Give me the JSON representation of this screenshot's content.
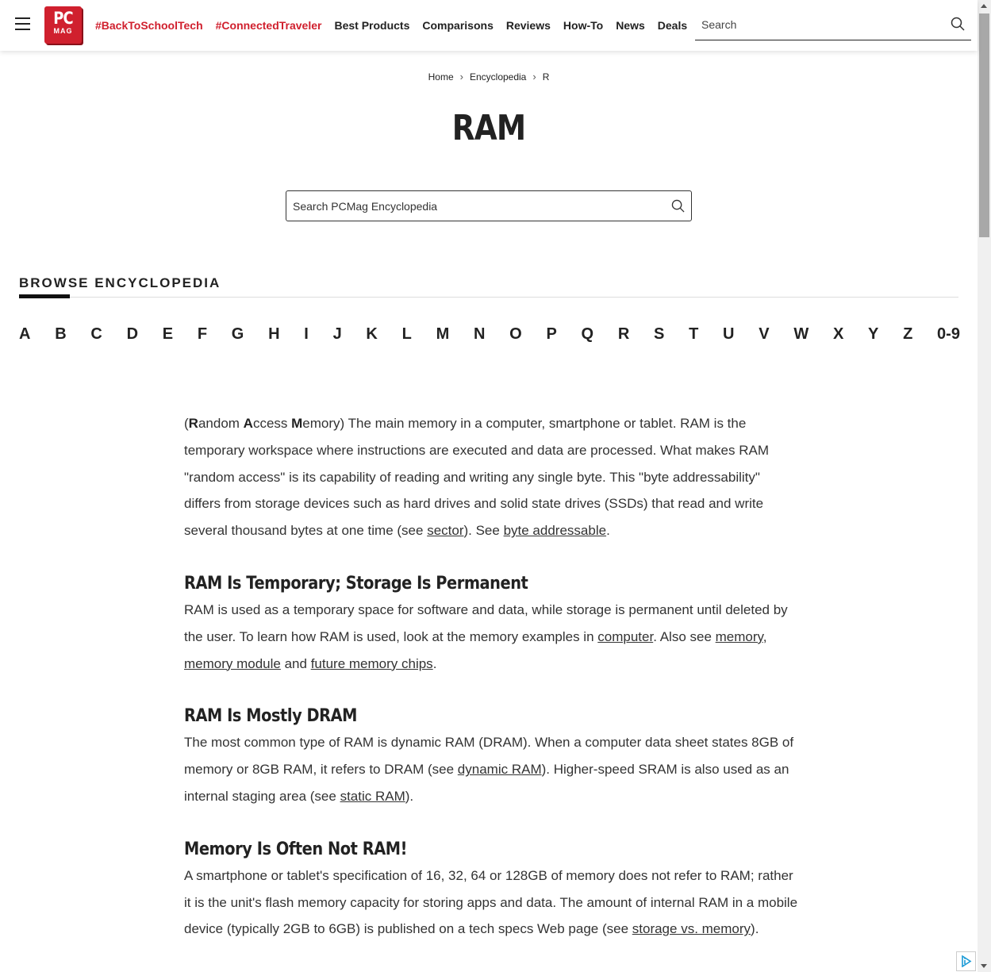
{
  "header": {
    "logo_top": "PC",
    "logo_bottom": "MAG",
    "nav": [
      {
        "label": "#BackToSchoolTech",
        "hot": true
      },
      {
        "label": "#ConnectedTraveler",
        "hot": true
      },
      {
        "label": "Best Products"
      },
      {
        "label": "Comparisons"
      },
      {
        "label": "Reviews"
      },
      {
        "label": "How-To"
      },
      {
        "label": "News"
      },
      {
        "label": "Deals"
      }
    ],
    "search_placeholder": "Search"
  },
  "breadcrumb": {
    "home": "Home",
    "encyclopedia": "Encyclopedia",
    "current": "R"
  },
  "title": "RAM",
  "encyclopedia_search_placeholder": "Search PCMag Encyclopedia",
  "browse": {
    "heading": "BROWSE ENCYCLOPEDIA",
    "letters": [
      "A",
      "B",
      "C",
      "D",
      "E",
      "F",
      "G",
      "H",
      "I",
      "J",
      "K",
      "L",
      "M",
      "N",
      "O",
      "P",
      "Q",
      "R",
      "S",
      "T",
      "U",
      "V",
      "W",
      "X",
      "Y",
      "Z",
      "0-9"
    ]
  },
  "article": {
    "intro": {
      "p0": "(",
      "b1": "R",
      "t1": "andom ",
      "b2": "A",
      "t2": "ccess ",
      "b3": "M",
      "t3": "emory) The main memory in a computer, smartphone or tablet. RAM is the temporary workspace where instructions are executed and data are processed. What makes RAM \"random access\" is its capability of reading and writing any single byte. This \"byte addressability\" differs from storage devices such as hard drives and solid state drives (SSDs) that read and write several thousand bytes at one time (see ",
      "link1": "sector",
      "t4": "). See ",
      "link2": "byte addressable",
      "t5": "."
    },
    "section1": {
      "heading": "RAM Is Temporary; Storage Is Permanent",
      "t1": "RAM is used as a temporary space for software and data, while storage is permanent until deleted by the user. To learn how RAM is used, look at the memory examples in ",
      "link1": "computer",
      "t2": ". Also see ",
      "link2": "memory",
      "t3": ", ",
      "link3": "memory module",
      "t4": " and ",
      "link4": "future memory chips",
      "t5": "."
    },
    "section2": {
      "heading": "RAM Is Mostly DRAM",
      "t1": "The most common type of RAM is dynamic RAM (DRAM). When a computer data sheet states 8GB of memory or 8GB RAM, it refers to DRAM (see ",
      "link1": "dynamic RAM",
      "t2": "). Higher-speed SRAM is also used as an internal staging area (see ",
      "link2": "static RAM",
      "t3": ")."
    },
    "section3": {
      "heading": "Memory Is Often Not RAM!",
      "t1": "A smartphone or tablet's specification of 16, 32, 64 or 128GB of memory does not refer to RAM; rather it is the unit's flash memory capacity for storing apps and data. The amount of internal RAM in a mobile device (typically 2GB to 6GB) is published on a tech specs Web page (see ",
      "link1": "storage vs. memory",
      "t2": ")."
    }
  }
}
